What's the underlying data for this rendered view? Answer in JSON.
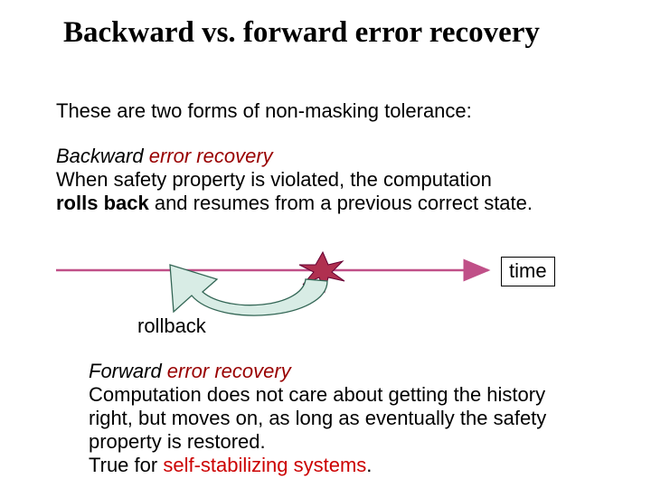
{
  "title": "Backward vs. forward error recovery",
  "intro": "These are two forms of non-masking tolerance:",
  "backward": {
    "heading_plain": "Backward ",
    "heading_colored": "error recovery",
    "line1a": "When safety property is violated, the computation",
    "rolls_back": "rolls back",
    "line2b": " and resumes from a previous correct state."
  },
  "diagram": {
    "time_label": "time",
    "rollback_label": "rollback"
  },
  "forward": {
    "heading_plain": "Forward ",
    "heading_colored": "error recovery",
    "line1": "Computation does not care about getting the history",
    "line2": "right, but moves on, as long as eventually the safety",
    "line3": "property is restored.",
    "line4a": "True for ",
    "self_stab": "self-stabilizing systems",
    "line4b": "."
  }
}
